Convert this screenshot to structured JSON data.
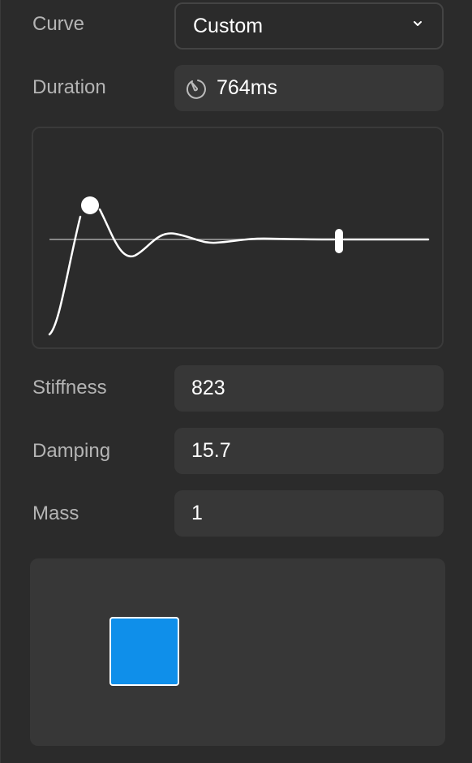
{
  "curve": {
    "label": "Curve",
    "value": "Custom"
  },
  "duration": {
    "label": "Duration",
    "value": "764ms",
    "icon": "timer-icon"
  },
  "stiffness": {
    "label": "Stiffness",
    "value": "823"
  },
  "damping": {
    "label": "Damping",
    "value": "15.7"
  },
  "mass": {
    "label": "Mass",
    "value": "1"
  },
  "colors": {
    "preview_box": "#0f8fea",
    "background": "#2b2b2b",
    "field": "#373737"
  }
}
